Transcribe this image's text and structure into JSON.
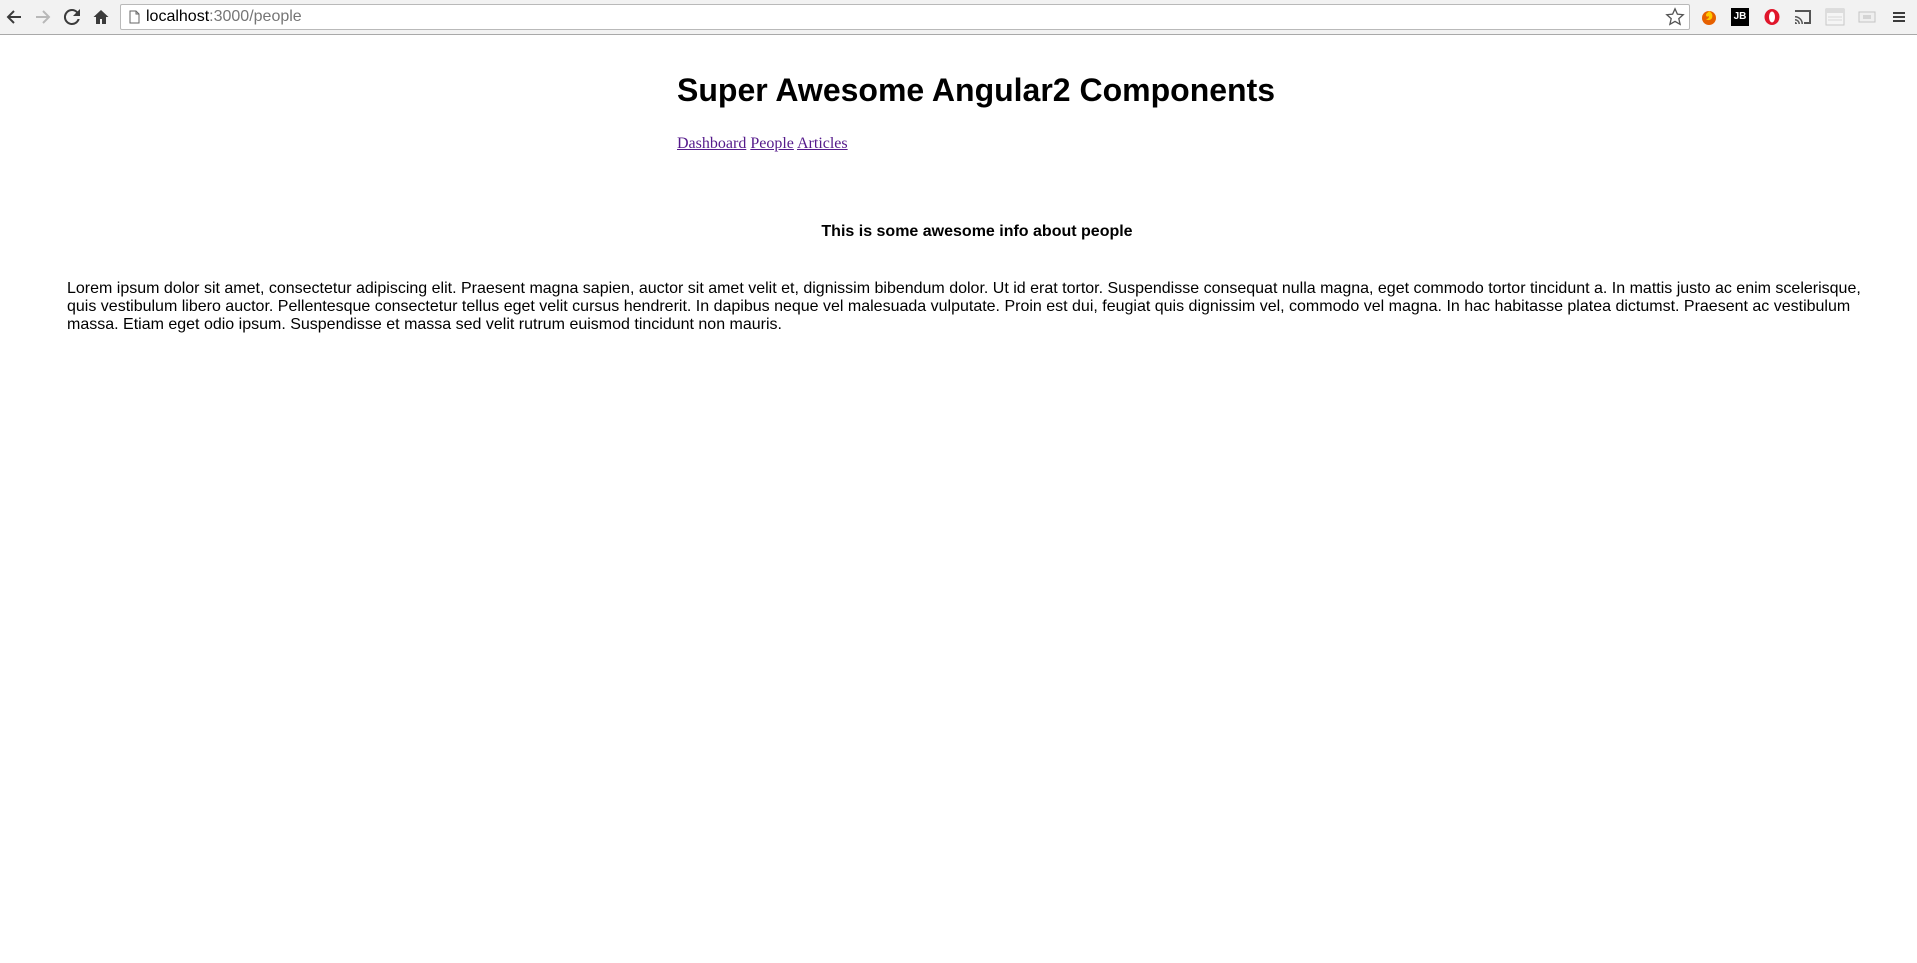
{
  "browser": {
    "url_host": "localhost",
    "url_path": ":3000/people",
    "icons": [
      "back-icon",
      "forward-icon",
      "reload-icon",
      "home-icon",
      "page-icon",
      "bookmark-star-icon",
      "firefox-extension-icon",
      "jetbrains-extension-icon",
      "opera-extension-icon",
      "cast-icon",
      "window-extension-icon",
      "screen-extension-icon",
      "menu-icon"
    ],
    "jb_label": "JB"
  },
  "page": {
    "title": "Super Awesome Angular2 Components",
    "nav": [
      {
        "label": "Dashboard"
      },
      {
        "label": "People"
      },
      {
        "label": "Articles"
      }
    ],
    "section_heading": "This is some awesome info about people",
    "body": "Lorem ipsum dolor sit amet, consectetur adipiscing elit. Praesent magna sapien, auctor sit amet velit et, dignissim bibendum dolor. Ut id erat tortor. Suspendisse consequat nulla magna, eget commodo tortor tincidunt a. In mattis justo ac enim scelerisque, quis vestibulum libero auctor. Pellentesque consectetur tellus eget velit cursus hendrerit. In dapibus neque vel malesuada vulputate. Proin est dui, feugiat quis dignissim vel, commodo vel magna. In hac habitasse platea dictumst. Praesent ac vestibulum massa. Etiam eget odio ipsum. Suspendisse et massa sed velit rutrum euismod tincidunt non mauris."
  },
  "colors": {
    "link_visited": "#551a8b",
    "text": "#000000",
    "url_path": "#767676",
    "toolbar_bg": "#f2f2f2"
  }
}
